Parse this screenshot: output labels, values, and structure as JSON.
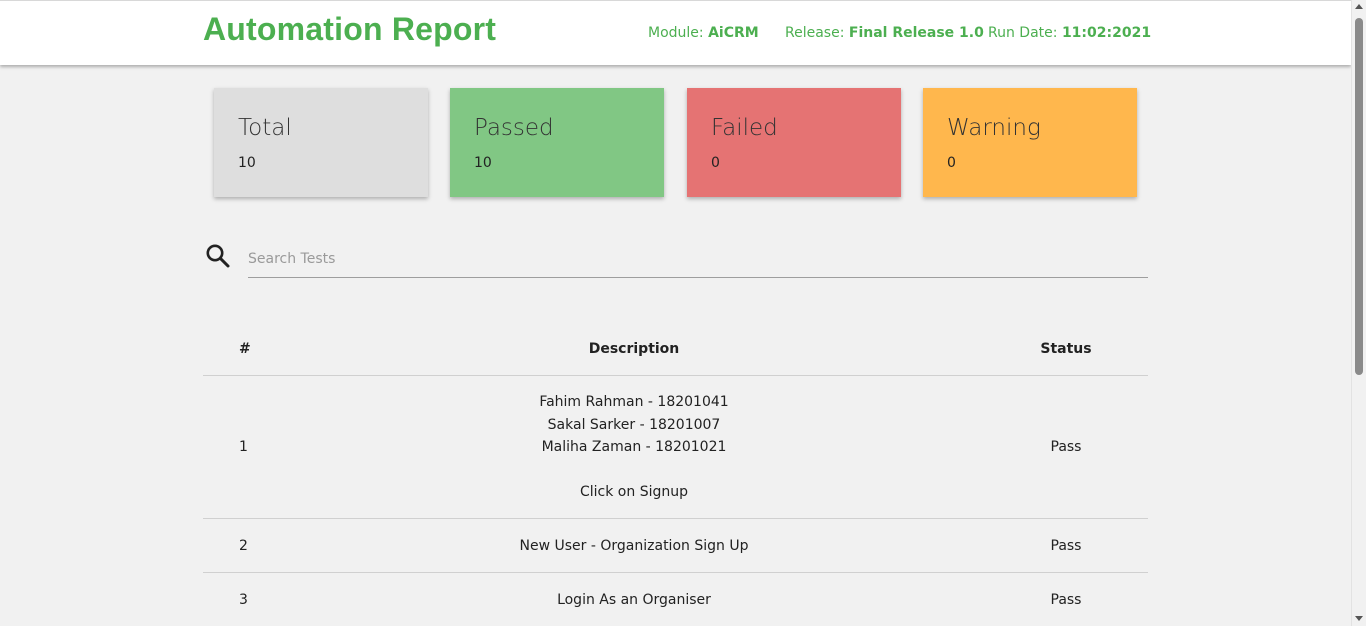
{
  "header": {
    "title": "Automation Report",
    "module_label": "Module:",
    "module_value": "AiCRM",
    "release_label": "Release:",
    "release_value": "Final Release 1.0",
    "run_date_label": "Run Date:",
    "run_date_value": "11:02:2021",
    "accent_color": "#4caf50"
  },
  "stats": [
    {
      "label": "Total",
      "value": "10",
      "color": "#dedede"
    },
    {
      "label": "Passed",
      "value": "10",
      "color": "#81c784"
    },
    {
      "label": "Failed",
      "value": "0",
      "color": "#e57373"
    },
    {
      "label": "Warning",
      "value": "0",
      "color": "#ffb74d"
    }
  ],
  "search": {
    "placeholder": "Search Tests",
    "value": "",
    "icon": "search-icon"
  },
  "table": {
    "headers": [
      "#",
      "Description",
      "Status"
    ],
    "rows": [
      {
        "num": "1",
        "description_lines": [
          "Fahim Rahman - 18201041",
          "Sakal Sarker - 18201007",
          "Maliha Zaman - 18201021",
          "",
          "Click on Signup"
        ],
        "status": "Pass"
      },
      {
        "num": "2",
        "description_lines": [
          "New User - Organization Sign Up"
        ],
        "status": "Pass"
      },
      {
        "num": "3",
        "description_lines": [
          "Login As an Organiser"
        ],
        "status": "Pass"
      }
    ]
  }
}
